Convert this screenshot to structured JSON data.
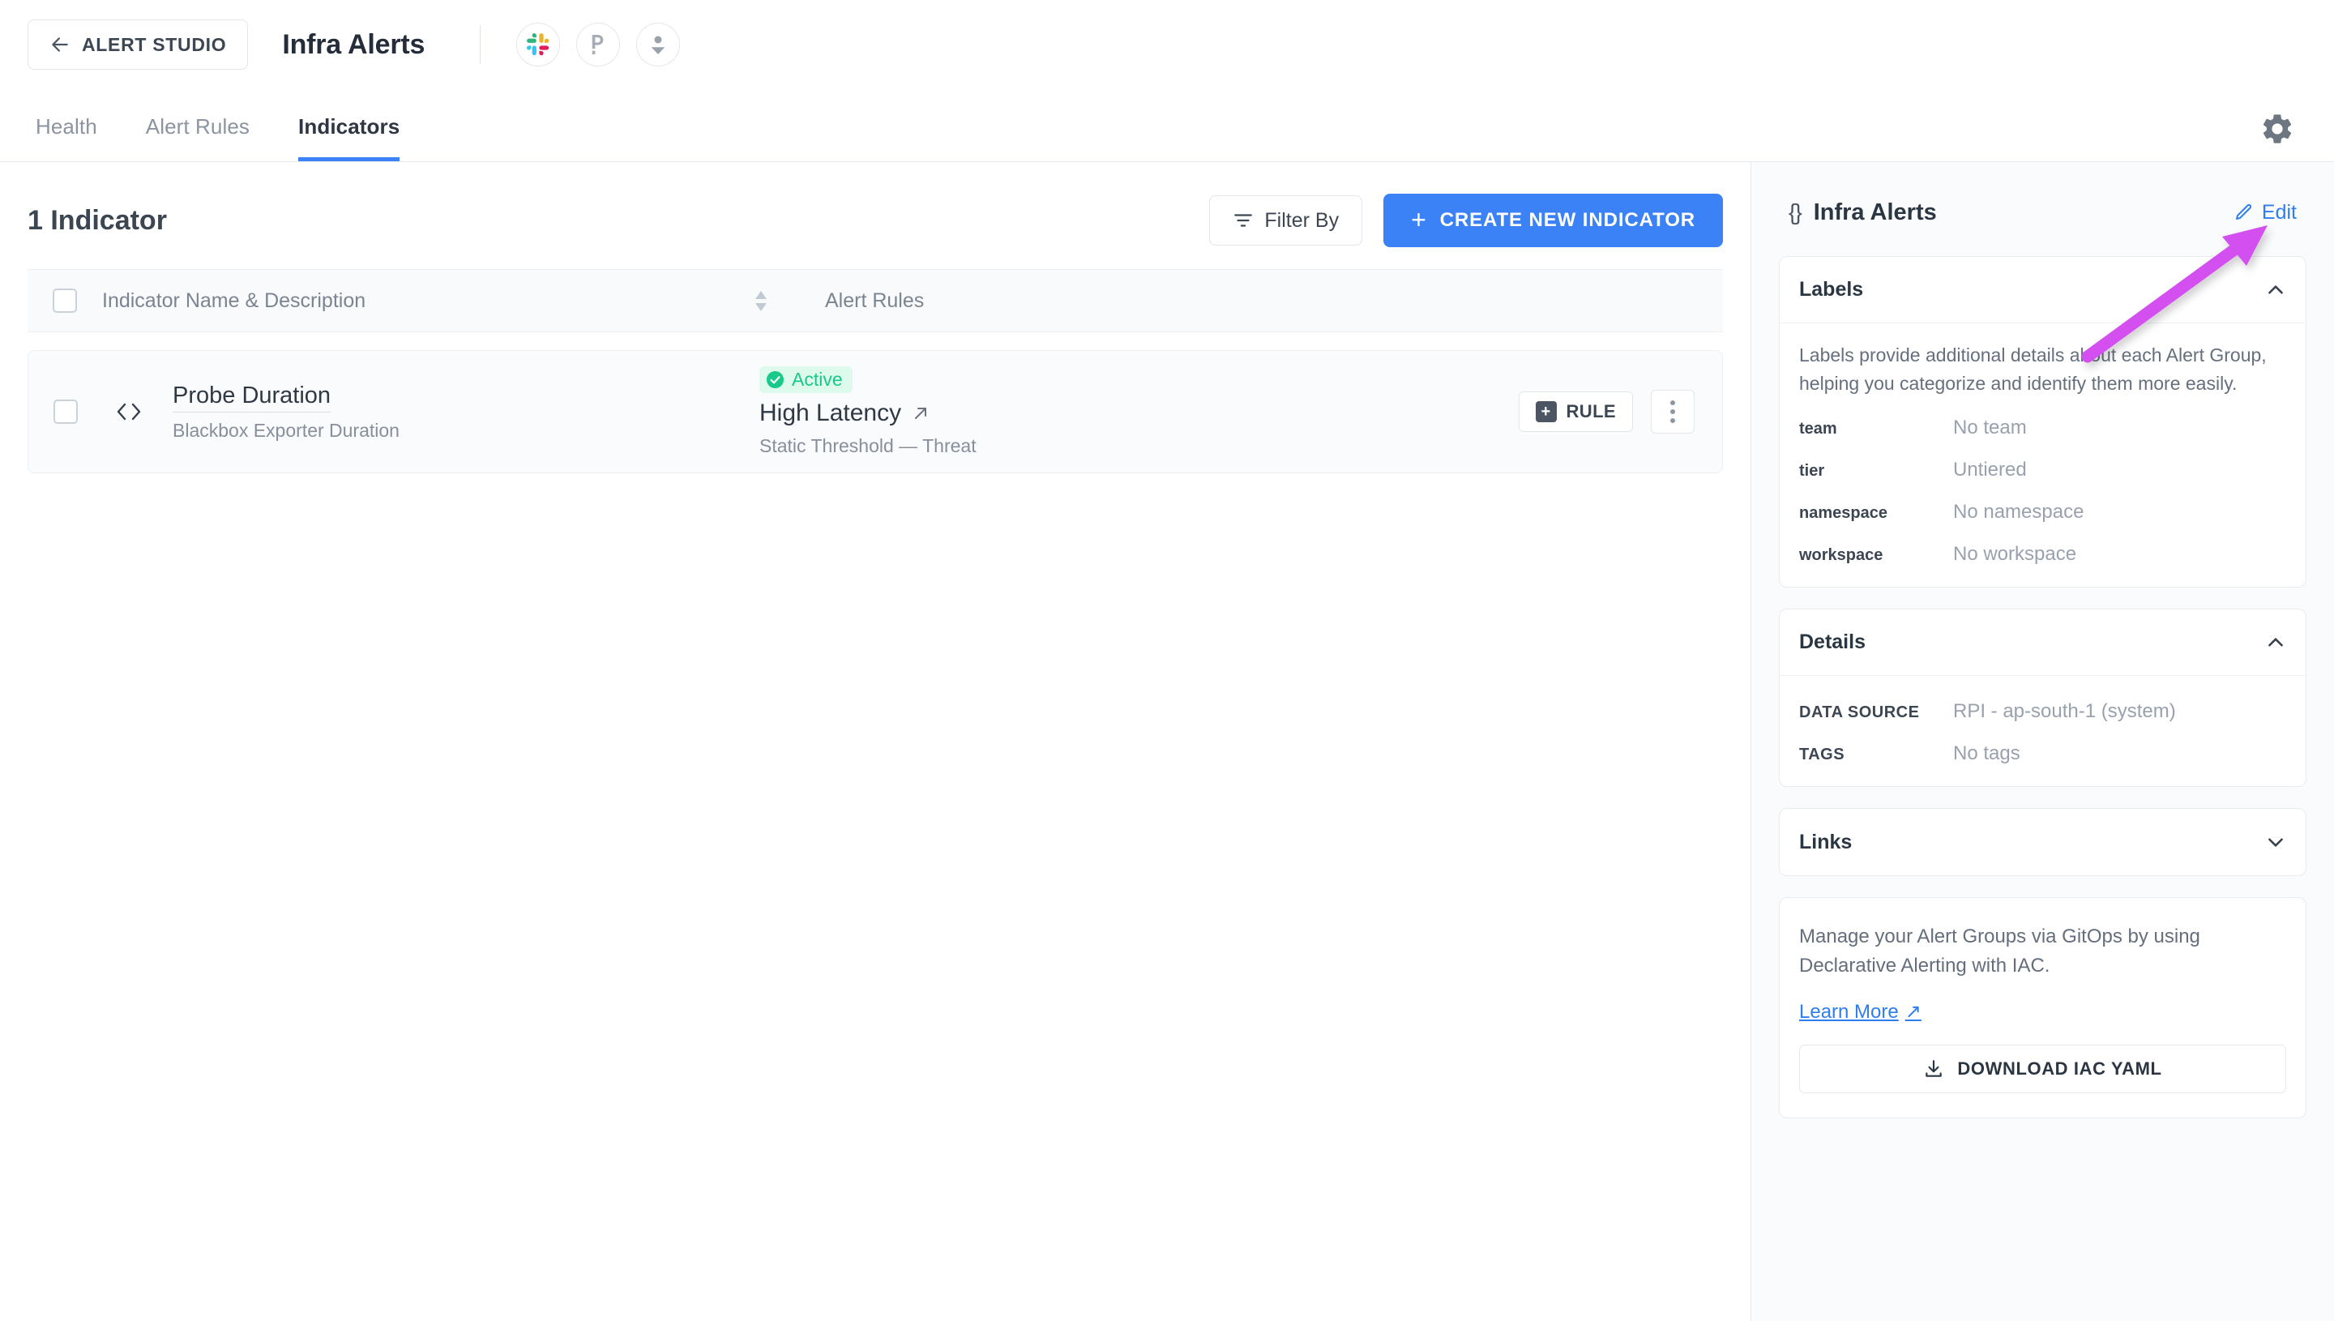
{
  "topbar": {
    "back_label": "ALERT STUDIO",
    "app_title": "Infra Alerts",
    "icons": [
      {
        "name": "slack-icon",
        "label": "Slack"
      },
      {
        "name": "pagerduty-icon",
        "label": "PagerDuty"
      },
      {
        "name": "user-icon",
        "label": "User"
      }
    ]
  },
  "tabs": [
    {
      "label": "Health",
      "active": false
    },
    {
      "label": "Alert Rules",
      "active": false
    },
    {
      "label": "Indicators",
      "active": true
    }
  ],
  "settings_icon": "gear-icon",
  "main": {
    "count_title": "1 Indicator",
    "filter_label": "Filter By",
    "create_label": "CREATE NEW INDICATOR",
    "create_plus": "+",
    "accent_color": "#3b82f6",
    "table": {
      "columns": [
        {
          "label": "Indicator Name & Description",
          "sortable": true
        },
        {
          "label": "Alert Rules",
          "sortable": false
        }
      ],
      "rows": [
        {
          "indicator_name": "Probe Duration",
          "indicator_description": "Blackbox Exporter Duration",
          "status_badge": "Active",
          "status_color": "#18c98b",
          "rule_name": "High Latency",
          "rule_subtitle": "Static Threshold — Threat",
          "rule_chip_label": "RULE",
          "chip_plus": "+"
        }
      ]
    }
  },
  "side_panel": {
    "title": "Infra Alerts",
    "brace_icon": "{}",
    "edit_label": "Edit",
    "edit_color": "#2f7ef0",
    "sections": [
      {
        "key": "labels",
        "title": "Labels",
        "expanded": true,
        "description": "Labels provide additional details about each Alert Group, helping you categorize and identify them more easily.",
        "rows": [
          {
            "key": "team",
            "value": "No team"
          },
          {
            "key": "tier",
            "value": "Untiered"
          },
          {
            "key": "namespace",
            "value": "No namespace"
          },
          {
            "key": "workspace",
            "value": "No workspace"
          }
        ]
      },
      {
        "key": "details",
        "title": "Details",
        "expanded": true,
        "rows": [
          {
            "key": "DATA SOURCE",
            "value": "RPI - ap-south-1 (system)"
          },
          {
            "key": "TAGS",
            "value": "No tags"
          }
        ]
      },
      {
        "key": "links",
        "title": "Links",
        "expanded": false,
        "rows": []
      }
    ],
    "iac": {
      "text": "Manage your Alert Groups via GitOps by using Declarative Alerting with IAC.",
      "learn_more_label": "Learn More",
      "learn_more_arrow": "↗",
      "download_label": "DOWNLOAD IAC YAML"
    }
  },
  "annotation": {
    "type": "arrow",
    "color": "#d44ff0",
    "points_to": "edit-link"
  }
}
